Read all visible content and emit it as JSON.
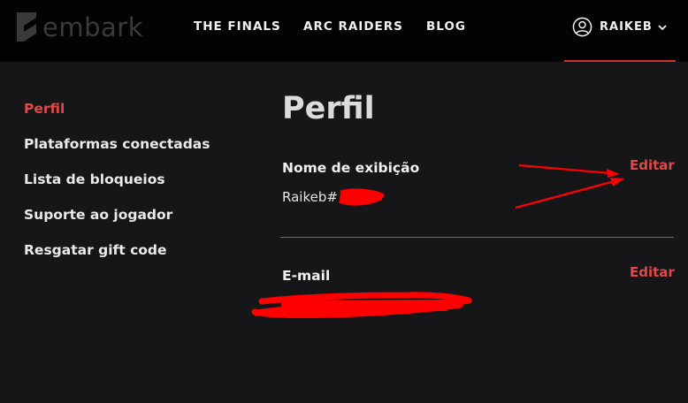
{
  "brand": {
    "name": "embark"
  },
  "nav": {
    "items": [
      {
        "label": "THE FINALS"
      },
      {
        "label": "ARC RAIDERS"
      },
      {
        "label": "BLOG"
      }
    ]
  },
  "user": {
    "name": "RAIKEB"
  },
  "sidebar": {
    "items": [
      {
        "label": "Perfil",
        "active": true
      },
      {
        "label": "Plataformas conectadas"
      },
      {
        "label": "Lista de bloqueios"
      },
      {
        "label": "Suporte ao jogador"
      },
      {
        "label": "Resgatar gift code"
      }
    ]
  },
  "profile": {
    "title": "Perfil",
    "display_name": {
      "label": "Nome de exibição",
      "value": "Raikeb#",
      "edit_label": "Editar"
    },
    "email": {
      "label": "E-mail",
      "edit_label": "Editar"
    }
  },
  "colors": {
    "accent": "#e04848",
    "background": "#161618",
    "topbar": "#030303",
    "annotation": "#ff0000"
  }
}
